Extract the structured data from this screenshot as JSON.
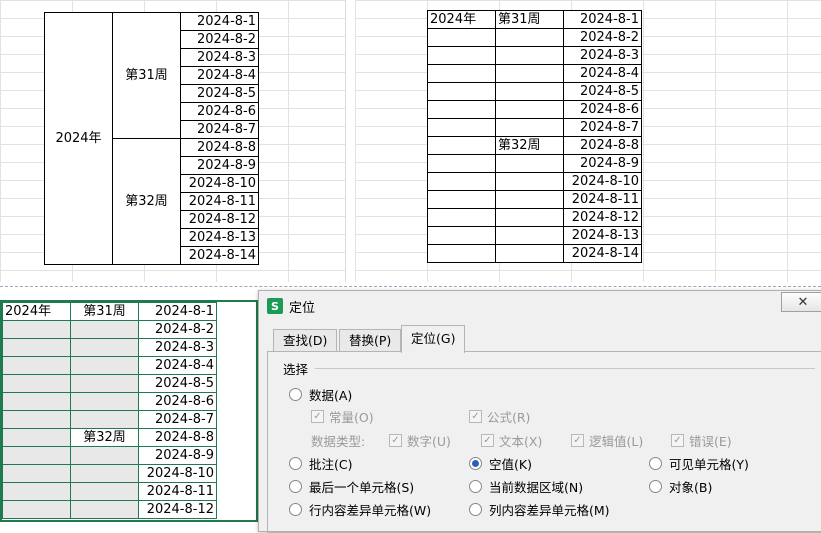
{
  "sheet1": {
    "year": "2024年",
    "weeks": [
      "第31周",
      "第32周"
    ],
    "dates": [
      "2024-8-1",
      "2024-8-2",
      "2024-8-3",
      "2024-8-4",
      "2024-8-5",
      "2024-8-6",
      "2024-8-7",
      "2024-8-8",
      "2024-8-9",
      "2024-8-10",
      "2024-8-11",
      "2024-8-12",
      "2024-8-13",
      "2024-8-14"
    ]
  },
  "sheet2": {
    "year": "2024年",
    "weeks": [
      "第31周",
      "第32周"
    ],
    "dates": [
      "2024-8-1",
      "2024-8-2",
      "2024-8-3",
      "2024-8-4",
      "2024-8-5",
      "2024-8-6",
      "2024-8-7",
      "2024-8-8",
      "2024-8-9",
      "2024-8-10",
      "2024-8-11",
      "2024-8-12",
      "2024-8-13",
      "2024-8-14"
    ]
  },
  "sheet3": {
    "year": "2024年",
    "weeks": [
      "第31周",
      "第32周"
    ],
    "dates": [
      "2024-8-1",
      "2024-8-2",
      "2024-8-3",
      "2024-8-4",
      "2024-8-5",
      "2024-8-6",
      "2024-8-7",
      "2024-8-8",
      "2024-8-9",
      "2024-8-10",
      "2024-8-11",
      "2024-8-12"
    ]
  },
  "dialog": {
    "app_icon": "S",
    "title": "定位",
    "close_glyph": "✕",
    "tabs": [
      "查找(D)",
      "替换(P)",
      "定位(G)"
    ],
    "section_label": "选择",
    "options": {
      "data": "数据(A)",
      "constants": "常量(O)",
      "formulas": "公式(R)",
      "data_type_label": "数据类型:",
      "numbers": "数字(U)",
      "text": "文本(X)",
      "logicals": "逻辑值(L)",
      "errors": "错误(E)",
      "comments": "批注(C)",
      "blanks": "空值(K)",
      "visible_cells": "可见单元格(Y)",
      "last_cell": "最后一个单元格(S)",
      "current_region": "当前数据区域(N)",
      "objects": "对象(B)",
      "row_differences": "行内容差异单元格(W)",
      "column_differences": "列内容差异单元格(M)"
    },
    "selected_option": "blanks",
    "check_mark": "✓"
  },
  "colors": {
    "selection_border": "#1f7a4d",
    "app_icon": "#1d9a55",
    "radio_selected": "#2b60b8"
  }
}
